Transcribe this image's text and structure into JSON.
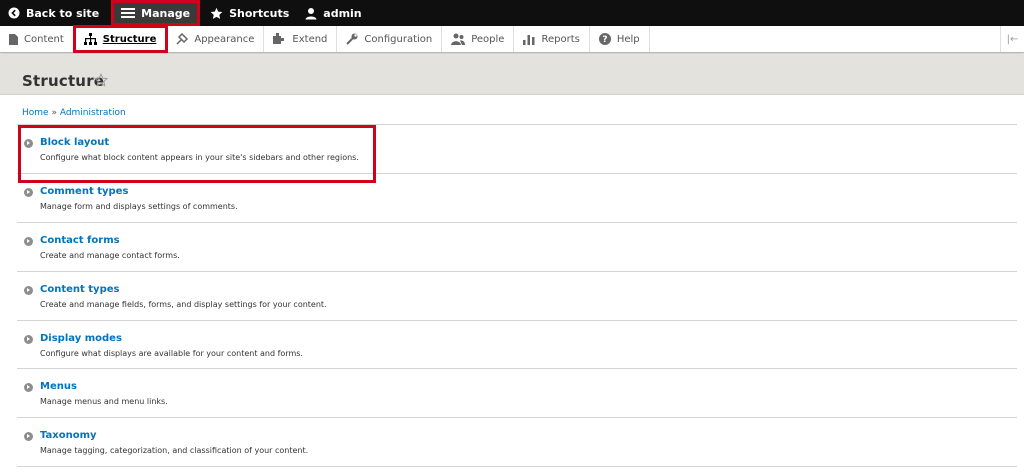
{
  "toolbar": {
    "back_to_site": "Back to site",
    "manage": "Manage",
    "shortcuts": "Shortcuts",
    "user": "admin"
  },
  "tray": {
    "tabs": [
      {
        "label": "Content",
        "icon": "content-icon"
      },
      {
        "label": "Structure",
        "icon": "structure-icon",
        "active": true
      },
      {
        "label": "Appearance",
        "icon": "appearance-icon"
      },
      {
        "label": "Extend",
        "icon": "extend-icon"
      },
      {
        "label": "Configuration",
        "icon": "configuration-icon"
      },
      {
        "label": "People",
        "icon": "people-icon"
      },
      {
        "label": "Reports",
        "icon": "reports-icon"
      },
      {
        "label": "Help",
        "icon": "help-icon"
      }
    ],
    "collapse_glyph": "|←"
  },
  "page": {
    "title": "Structure",
    "breadcrumb": [
      "Home",
      "Administration"
    ],
    "breadcrumb_separator": "»"
  },
  "items": [
    {
      "title": "Block layout",
      "description": "Configure what block content appears in your site's sidebars and other regions."
    },
    {
      "title": "Comment types",
      "description": "Manage form and displays settings of comments."
    },
    {
      "title": "Contact forms",
      "description": "Create and manage contact forms."
    },
    {
      "title": "Content types",
      "description": "Create and manage fields, forms, and display settings for your content."
    },
    {
      "title": "Display modes",
      "description": "Configure what displays are available for your content and forms."
    },
    {
      "title": "Menus",
      "description": "Manage menus and menu links."
    },
    {
      "title": "Taxonomy",
      "description": "Manage tagging, categorization, and classification of your content."
    }
  ],
  "colors": {
    "highlight": "#d0021b",
    "link": "#0074bd",
    "toolbar_bg": "#0f0f0f",
    "header_bg": "#e4e2dd"
  }
}
